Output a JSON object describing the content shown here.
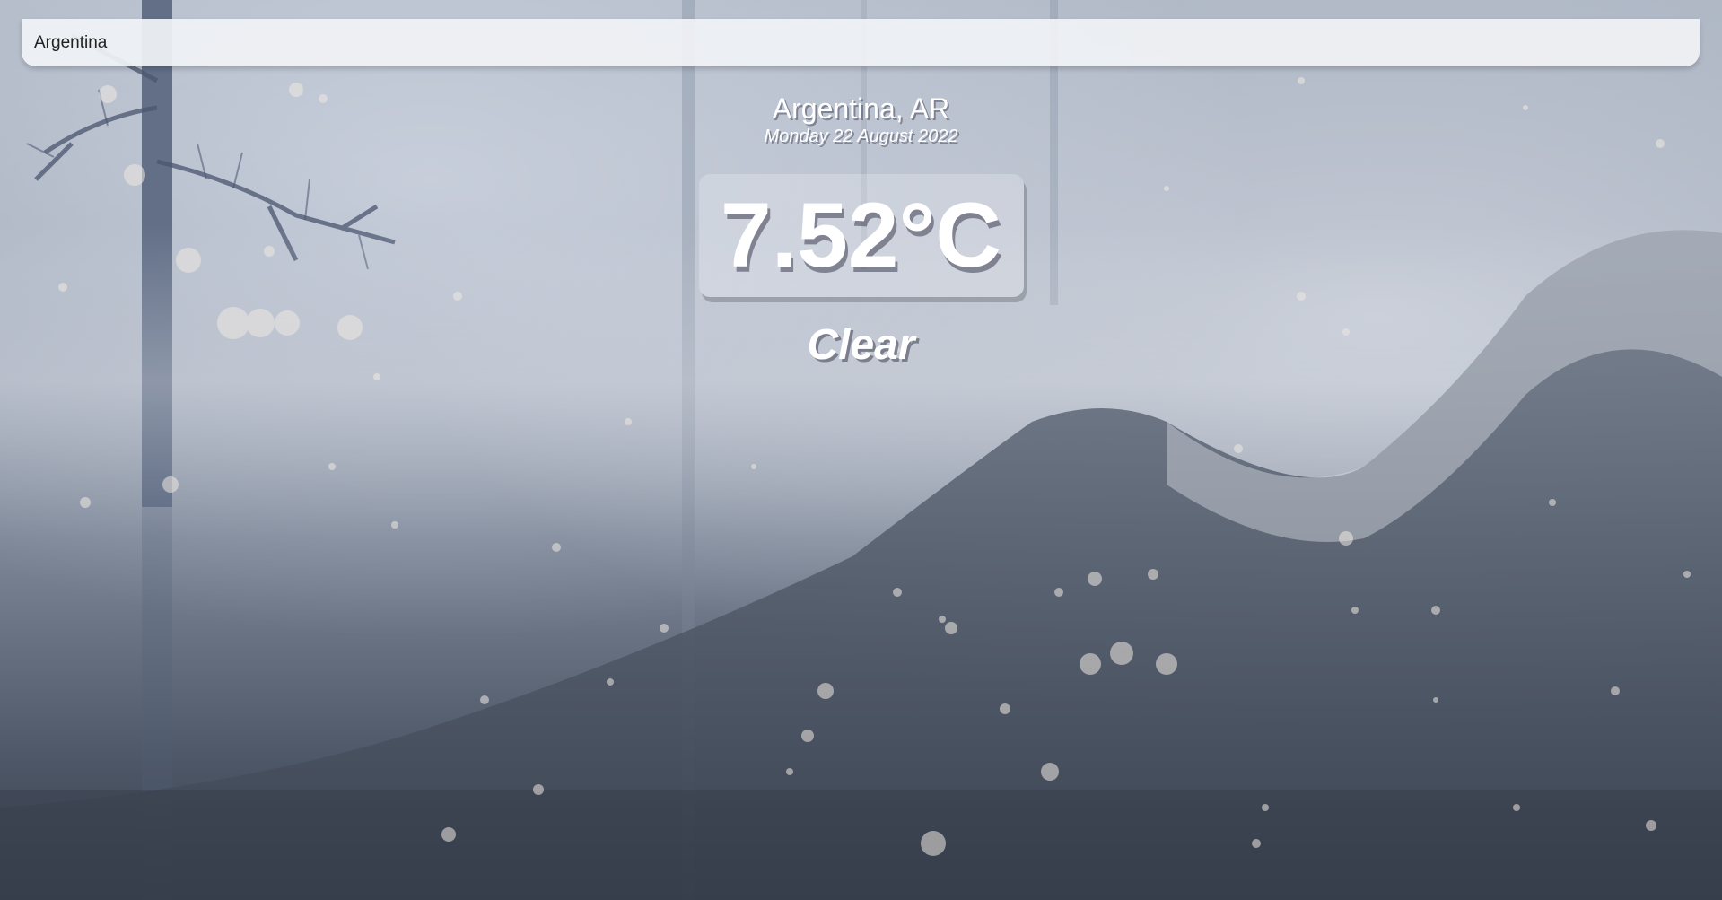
{
  "search": {
    "value": "Argentina"
  },
  "location": {
    "name": "Argentina, AR",
    "date": "Monday 22 August 2022"
  },
  "weather": {
    "temperature": "7.52°C",
    "condition": "Clear"
  },
  "background": {
    "theme": "cold-snowy-forest",
    "colors": {
      "sky": "#aab3c2",
      "mountain": "#5b6576",
      "ground": "#3a4250"
    }
  }
}
